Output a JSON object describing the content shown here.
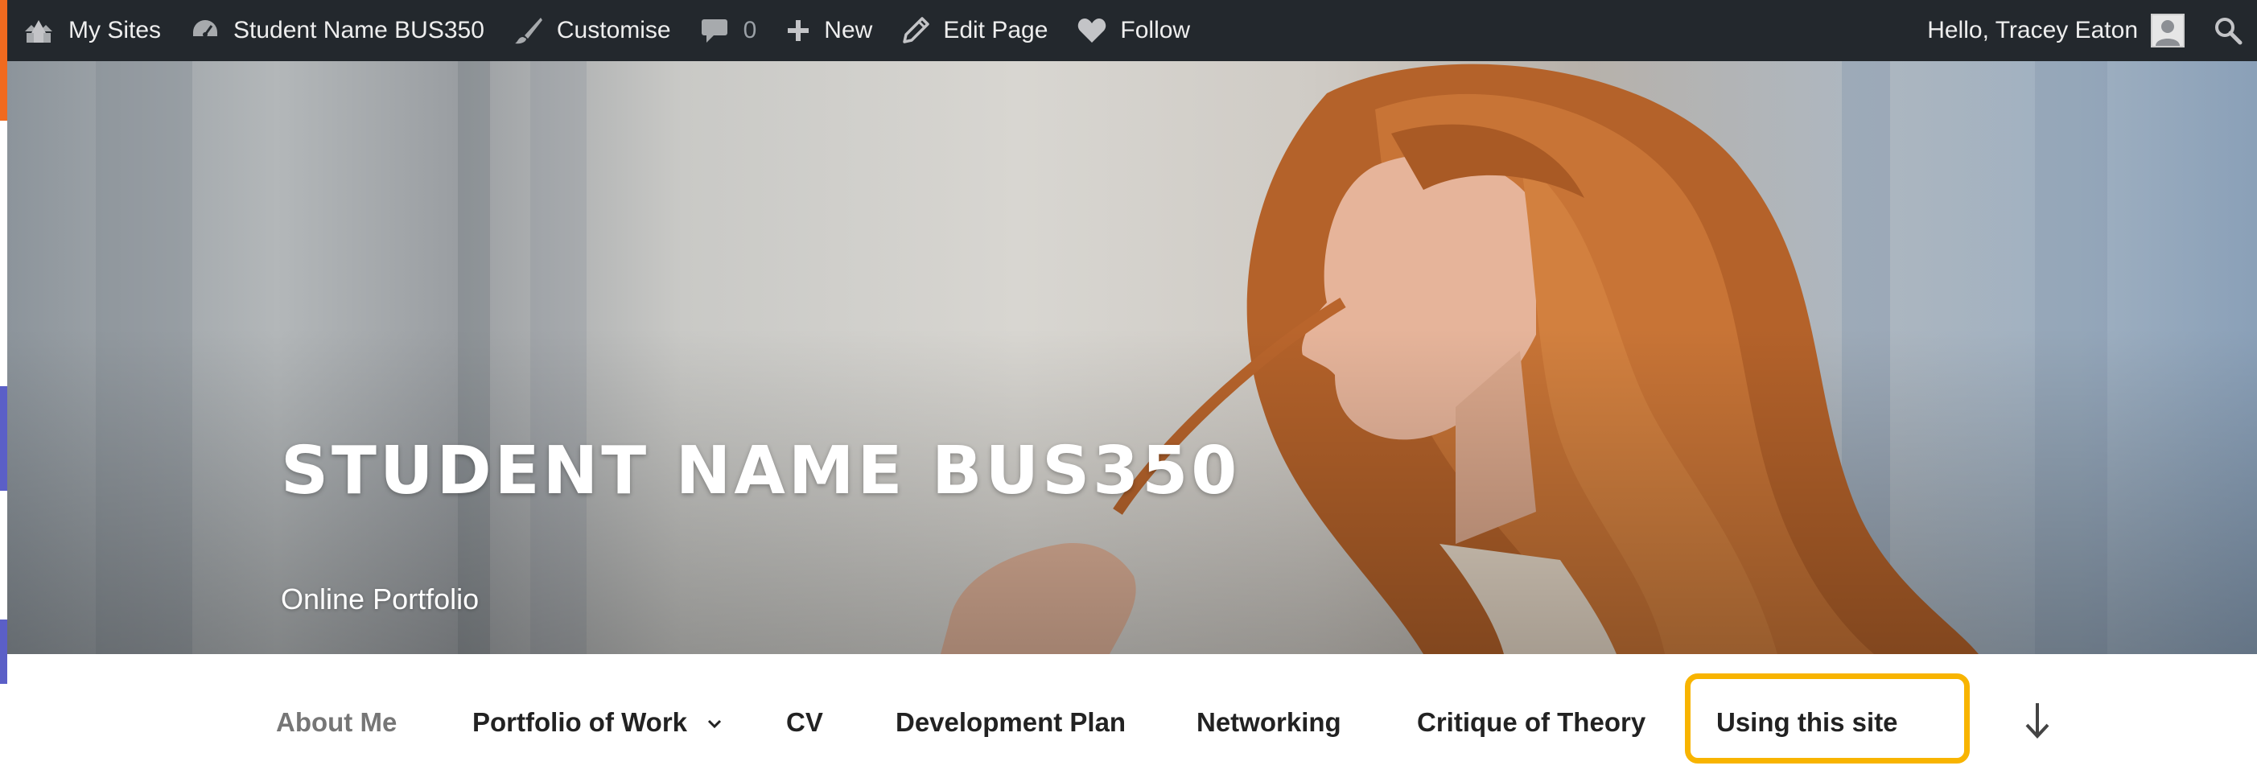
{
  "adminbar": {
    "my_sites": "My Sites",
    "site_name": "Student Name BUS350",
    "customise": "Customise",
    "comments_count": "0",
    "new": "New",
    "edit_page": "Edit Page",
    "follow": "Follow",
    "greeting": "Hello, Tracey Eaton"
  },
  "header": {
    "site_title": "STUDENT NAME BUS350",
    "site_description": "Online Portfolio"
  },
  "nav": {
    "items": [
      {
        "label": "About Me"
      },
      {
        "label": "Portfolio of Work"
      },
      {
        "label": "CV"
      },
      {
        "label": "Development Plan"
      },
      {
        "label": "Networking"
      },
      {
        "label": "Critique of Theory"
      },
      {
        "label": "Using this site"
      }
    ]
  },
  "colors": {
    "adminbar_bg": "#23282d",
    "highlight": "#f8b400",
    "current_nav": "#767676"
  },
  "icons": [
    "my-sites-icon",
    "dashboard-icon",
    "brush-icon",
    "comment-icon",
    "plus-icon",
    "pencil-icon",
    "heart-icon",
    "avatar-icon",
    "search-icon",
    "chevron-down-icon",
    "arrow-down-icon"
  ]
}
